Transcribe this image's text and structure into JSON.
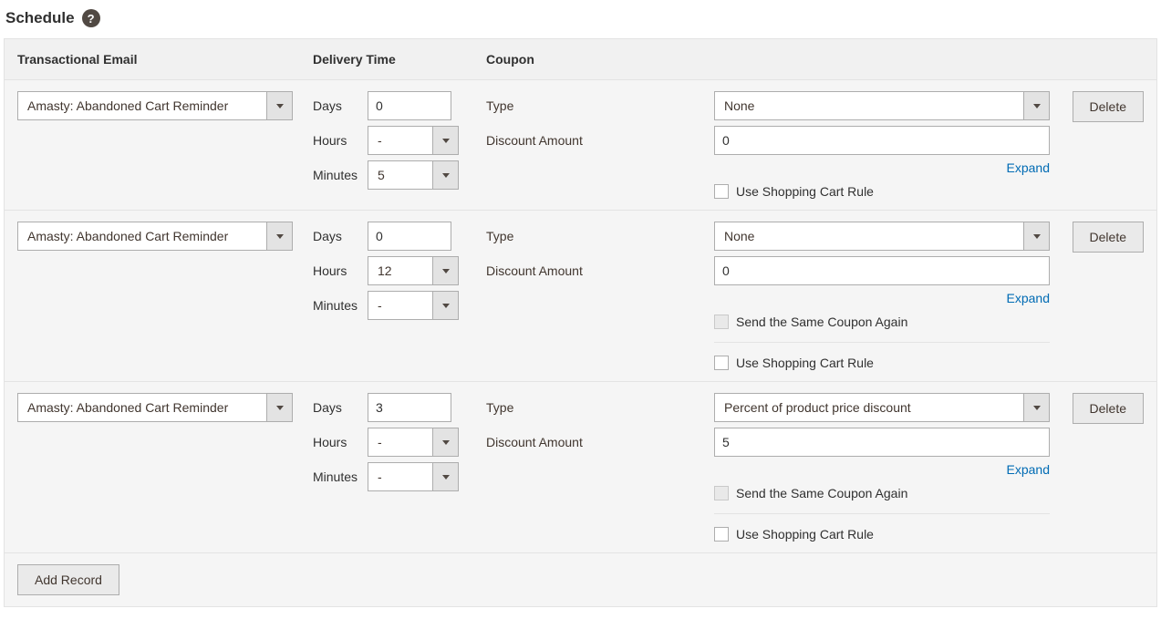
{
  "section": {
    "title": "Schedule"
  },
  "headers": {
    "email": "Transactional Email",
    "delivery": "Delivery Time",
    "coupon": "Coupon"
  },
  "labels": {
    "days": "Days",
    "hours": "Hours",
    "minutes": "Minutes",
    "type": "Type",
    "discount_amount": "Discount Amount",
    "expand": "Expand",
    "use_cart_rule": "Use Shopping Cart Rule",
    "same_coupon": "Send the Same Coupon Again",
    "delete": "Delete",
    "add_record": "Add Record"
  },
  "records": [
    {
      "email": "Amasty: Abandoned Cart Reminder",
      "days": "0",
      "hours": "-",
      "minutes": "5",
      "coupon_type": "None",
      "discount_amount": "0",
      "show_same_coupon": false
    },
    {
      "email": "Amasty: Abandoned Cart Reminder",
      "days": "0",
      "hours": "12",
      "minutes": "-",
      "coupon_type": "None",
      "discount_amount": "0",
      "show_same_coupon": true
    },
    {
      "email": "Amasty: Abandoned Cart Reminder",
      "days": "3",
      "hours": "-",
      "minutes": "-",
      "coupon_type": "Percent of product price discount",
      "discount_amount": "5",
      "show_same_coupon": true
    }
  ]
}
